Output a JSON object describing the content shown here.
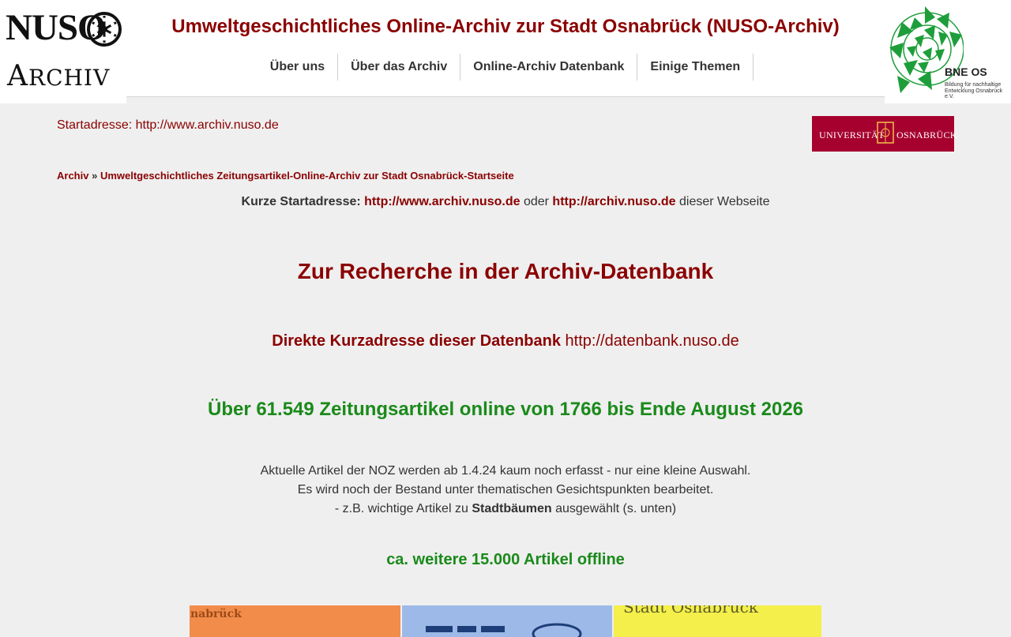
{
  "brand": {
    "logo_line1": "NUSO",
    "logo_line2_initial": "A",
    "logo_line2_rest": "RCHIV"
  },
  "header": {
    "title": "Umweltgeschichtliches Online-Archiv zur Stadt Osnabrück (NUSO-Archiv)",
    "nav": [
      "Über uns",
      "Über das Archiv",
      "Online-Archiv Datenbank",
      "Einige Themen"
    ]
  },
  "partner": {
    "name": "BNE OS",
    "subtitle": "Bildung für nachhaltige Entwicklung Osnabrück e.V.",
    "color": "#1e9e3a"
  },
  "university_logo": {
    "left": "UNIVERSITÄT",
    "right": "OSNABRÜCK",
    "color": "#a6002e"
  },
  "content": {
    "start_link": "Startadresse: http://www.archiv.nuso.de",
    "breadcrumb": {
      "root": "Archiv",
      "separator": "»",
      "current": "Umweltgeschichtliches Zeitungsartikel-Online-Archiv zur Stadt Osnabrück-Startseite"
    },
    "short_address": {
      "label": "Kurze Startadresse:",
      "link1": "http://www.archiv.nuso.de",
      "or": "oder",
      "link2": "http://archiv.nuso.de",
      "suffix": "dieser Webseite"
    },
    "research_link": "Zur Recherche in der Archiv-Datenbank",
    "direct": {
      "label": "Direkte Kurzadresse dieser Datenbank",
      "link": "http://datenbank.nuso.de"
    },
    "count_headline": "Über 61.549 Zeitungsartikel online von 1766 bis Ende August 2026",
    "notes": {
      "line1": "Aktuelle Artikel der NOZ werden ab 1.4.24 kaum noch erfasst - nur eine kleine Auswahl.",
      "line2": "Es wird noch der Bestand unter thematischen Gesichtspunkten bearbeitet.",
      "line3_pre": "- z.B. wichtige Artikel zu",
      "line3_bold": "Stadtbäumen",
      "line3_post": "ausgewählt (s. unten)"
    },
    "offline": "ca. weitere 15.000 Artikel offline",
    "collage": {
      "tile1_text": "nabrück",
      "tile3_text": "Stadt Osnabrück"
    }
  },
  "colors": {
    "accent": "#8b0000",
    "green": "#1a8a1a",
    "background": "#efefef"
  }
}
